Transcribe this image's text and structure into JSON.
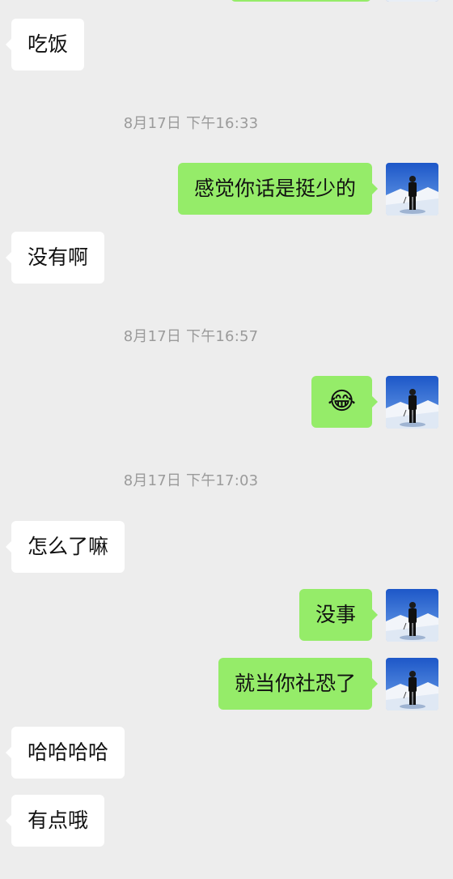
{
  "messages": [
    {
      "side": "in",
      "text": "吃饭"
    },
    {
      "type": "time",
      "text": "8月17日 下午16:33"
    },
    {
      "side": "out",
      "text": "感觉你话是挺少的"
    },
    {
      "side": "in",
      "text": "没有啊"
    },
    {
      "type": "time",
      "text": "8月17日 下午16:57"
    },
    {
      "side": "out",
      "text": "😂"
    },
    {
      "type": "time",
      "text": "8月17日 下午17:03"
    },
    {
      "side": "in",
      "text": "怎么了嘛"
    },
    {
      "side": "out",
      "text": "没事"
    },
    {
      "side": "out",
      "text": "就当你社恐了"
    },
    {
      "side": "in",
      "text": "哈哈哈哈"
    },
    {
      "side": "in",
      "text": "有点哦"
    }
  ],
  "colors": {
    "background": "#ededed",
    "outgoing_bubble": "#95ec69",
    "incoming_bubble": "#ffffff",
    "timestamp_text": "#9b9b9b"
  },
  "icons": {
    "avatar": "avatar-icon"
  }
}
